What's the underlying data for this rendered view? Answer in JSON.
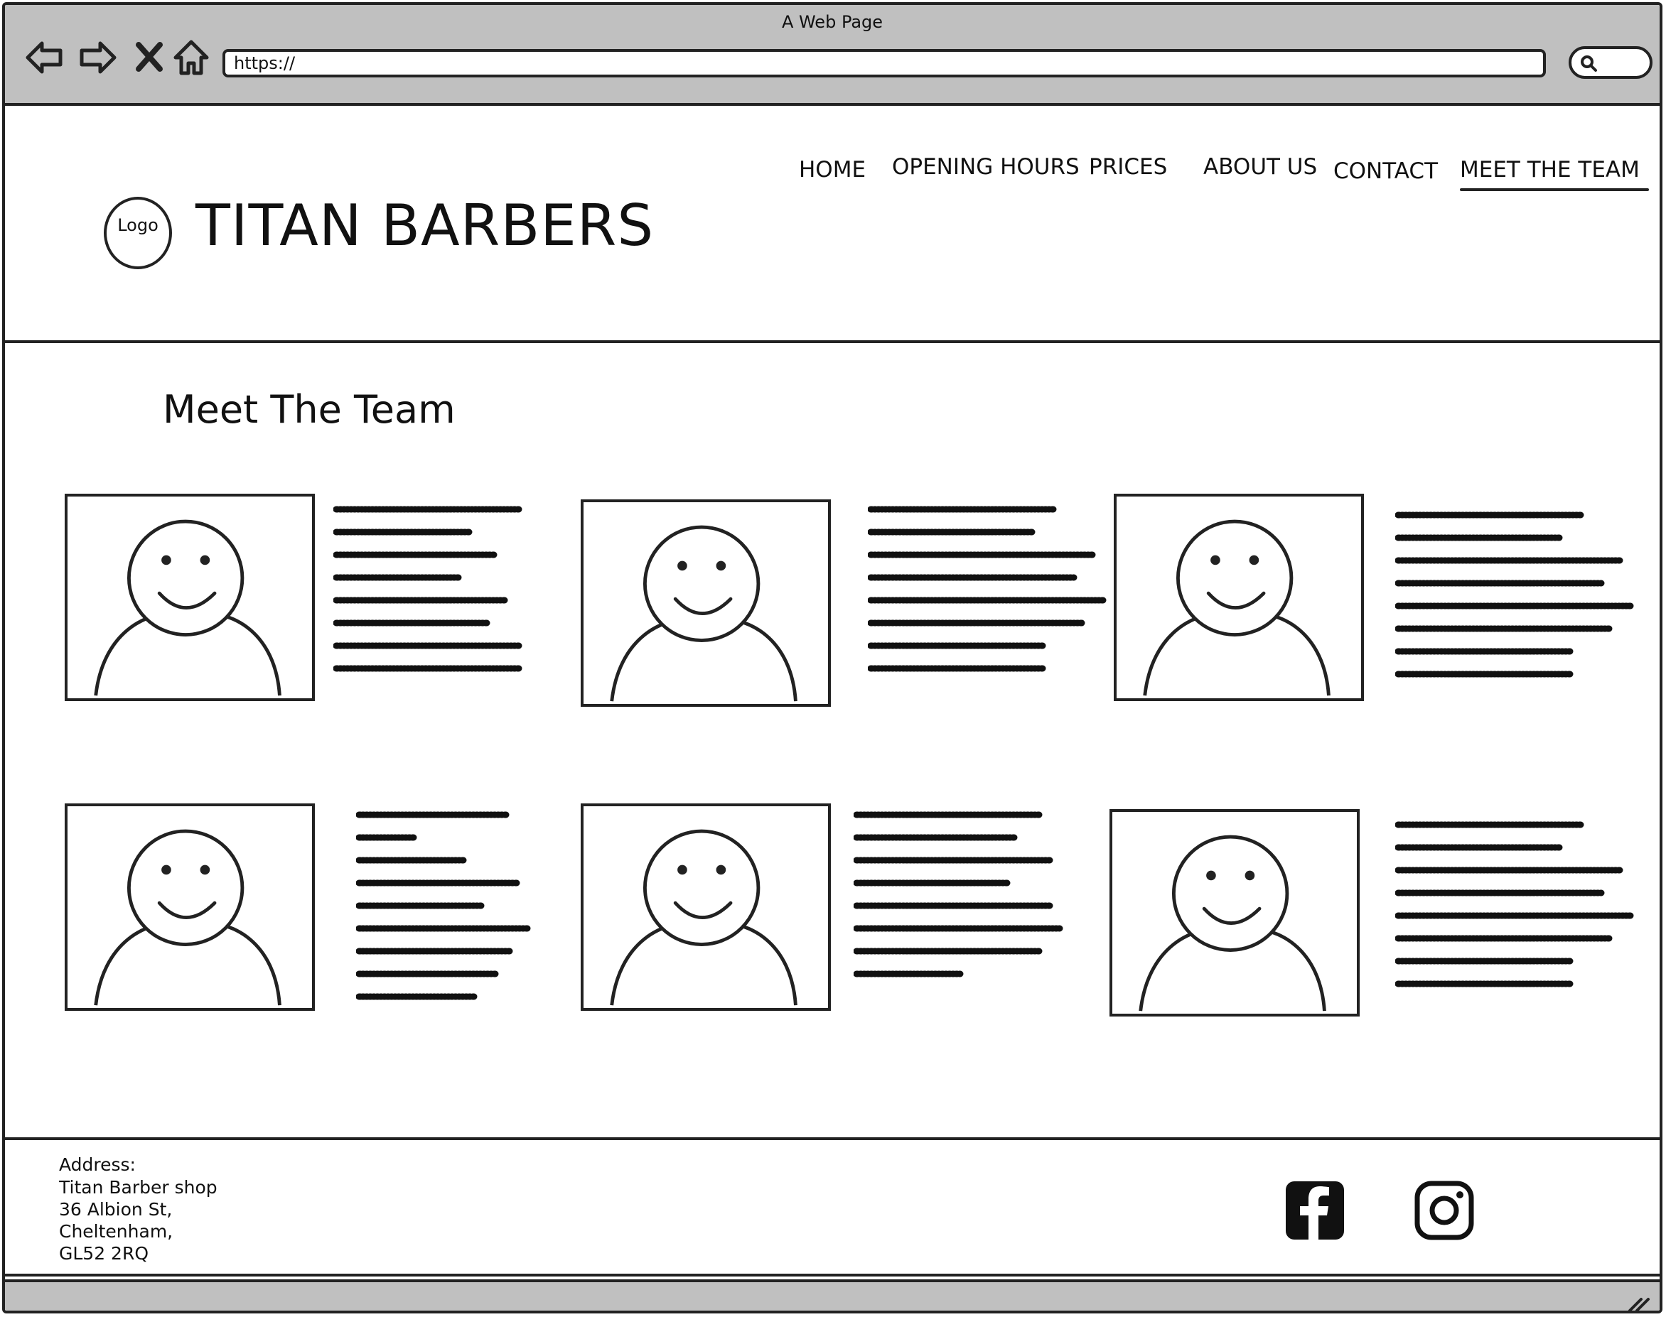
{
  "window": {
    "title": "A Web Page"
  },
  "browser": {
    "url": "https://",
    "icons": [
      "back-arrow-icon",
      "forward-arrow-icon",
      "close-x-icon",
      "home-icon",
      "search-icon"
    ]
  },
  "header": {
    "logo_text": "Logo",
    "brand": "TITAN BARBERS",
    "nav": [
      {
        "label": "HOME"
      },
      {
        "label": "OPENING HOURS"
      },
      {
        "label": "PRICES"
      },
      {
        "label": "ABOUT US"
      },
      {
        "label": "CONTACT"
      },
      {
        "label": "MEET THE TEAM",
        "active": true
      }
    ]
  },
  "main": {
    "heading": "Meet The Team",
    "team_cards": [
      {
        "image": "person-placeholder-icon",
        "text": "placeholder-scribble"
      },
      {
        "image": "person-placeholder-icon",
        "text": "placeholder-scribble"
      },
      {
        "image": "person-placeholder-icon",
        "text": "placeholder-scribble"
      },
      {
        "image": "person-placeholder-icon",
        "text": "placeholder-scribble"
      },
      {
        "image": "person-placeholder-icon",
        "text": "placeholder-scribble"
      },
      {
        "image": "person-placeholder-icon",
        "text": "placeholder-scribble"
      }
    ]
  },
  "footer": {
    "address_label": "Address:",
    "address_lines": [
      "Titan Barber shop",
      "36 Albion St,",
      "Cheltenham,",
      "GL52 2RQ"
    ],
    "social": [
      "facebook-icon",
      "instagram-icon"
    ]
  }
}
